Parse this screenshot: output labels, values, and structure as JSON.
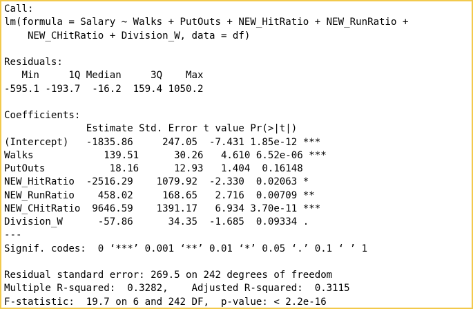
{
  "console": {
    "lines": [
      "Call:",
      "lm(formula = Salary ~ Walks + PutOuts + NEW_HitRatio + NEW_RunRatio +",
      "    NEW_CHitRatio + Division_W, data = df)",
      "",
      "Residuals:",
      "   Min     1Q Median     3Q    Max",
      "-595.1 -193.7  -16.2  159.4 1050.2",
      "",
      "Coefficients:",
      "              Estimate Std. Error t value Pr(>|t|)    ",
      "(Intercept)   -1835.86     247.05  -7.431 1.85e-12 ***",
      "Walks            139.51      30.26   4.610 6.52e-06 ***",
      "PutOuts           18.16      12.93   1.404  0.16148    ",
      "NEW_HitRatio  -2516.29    1079.92  -2.330  0.02063 *  ",
      "NEW_RunRatio    458.02     168.65   2.716  0.00709 ** ",
      "NEW_CHitRatio  9646.59    1391.17   6.934 3.70e-11 ***",
      "Division_W      -57.86      34.35  -1.685  0.09334 .  ",
      "---",
      "Signif. codes:  0 ‘***’ 0.001 ‘**’ 0.01 ‘*’ 0.05 ‘.’ 0.1 ‘ ’ 1",
      "",
      "Residual standard error: 269.5 on 242 degrees of freedom",
      "Multiple R-squared:  0.3282,    Adjusted R-squared:  0.3115 ",
      "F-statistic:  19.7 on 6 and 242 DF,  p-value: < 2.2e-16"
    ]
  },
  "colors": {
    "border": "#f2c94c",
    "text": "#000000",
    "background": "#ffffff"
  }
}
